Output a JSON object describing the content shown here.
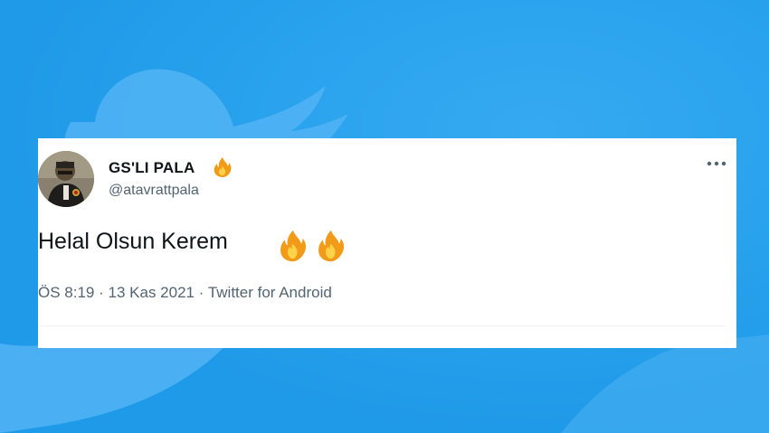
{
  "colors": {
    "background": "#2aa3ef",
    "bird": "#57b7f5",
    "card": "#ffffff",
    "name_text": "#0f1419",
    "secondary_text": "#536471"
  },
  "tweet": {
    "display_name": "GS'LI PALA",
    "name_badge_icon": "fire-emoji-icon",
    "handle": "@atavrattpala",
    "text": "Helal Olsun Kerem",
    "text_emojis": [
      "fire-emoji-icon",
      "fire-emoji-icon"
    ],
    "meta": {
      "time": "ÖS 8:19",
      "date": "13 Kas 2021",
      "source": "Twitter for Android",
      "separator": "·"
    },
    "more_icon": "more-options-icon"
  }
}
